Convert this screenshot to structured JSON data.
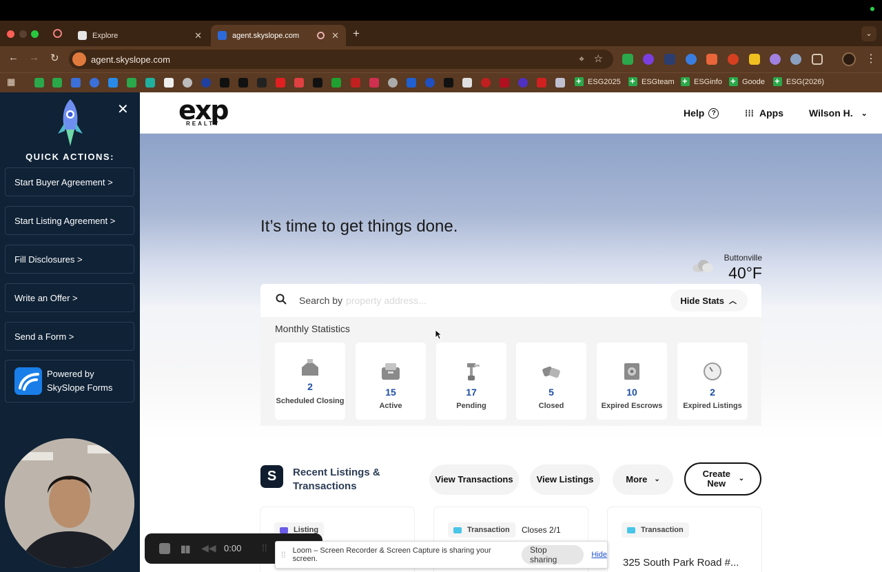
{
  "browser": {
    "tabs": [
      {
        "title": "Explore",
        "active": false
      },
      {
        "title": "agent.skyslope.com",
        "active": true
      }
    ],
    "url": "agent.skyslope.com",
    "bookmarks": [
      "ESG2025",
      "ESGteam",
      "ESGinfo",
      "Goode",
      "ESG(2026)"
    ]
  },
  "sidebar": {
    "title": "QUICK ACTIONS:",
    "actions": [
      "Start Buyer Agreement >",
      "Start Listing Agreement >",
      "Fill Disclosures >",
      "Write an Offer >",
      "Send a Form >"
    ],
    "powered_by": [
      "Powered by",
      "SkySlope Forms"
    ]
  },
  "header": {
    "logo_main": "exp",
    "logo_sub": "REALTY",
    "help": "Help",
    "apps": "Apps",
    "user": "Wilson H."
  },
  "hero": {
    "tagline": "It’s time to get things done.",
    "weather_city": "Buttonville",
    "weather_temp": "40°F",
    "search_label": "Search by",
    "search_placeholder": "property address...",
    "hide_stats": "Hide Stats"
  },
  "stats": {
    "title": "Monthly Statistics",
    "items": [
      {
        "value": "2",
        "label": "Scheduled Closing"
      },
      {
        "value": "15",
        "label": "Active"
      },
      {
        "value": "17",
        "label": "Pending"
      },
      {
        "value": "5",
        "label": "Closed"
      },
      {
        "value": "10",
        "label": "Expired Escrows"
      },
      {
        "value": "2",
        "label": "Expired Listings"
      }
    ]
  },
  "recent": {
    "title": "Recent Listings & Transactions",
    "view_transactions": "View Transactions",
    "view_listings": "View Listings",
    "more": "More",
    "create_new": "Create New",
    "cards": [
      {
        "type": "Listing",
        "closes": "",
        "address": "",
        "tag_color": "#6b5ce7"
      },
      {
        "type": "Transaction",
        "closes": "Closes 2/1",
        "address": "",
        "tag_color": "#49c5e8"
      },
      {
        "type": "Transaction",
        "closes": "",
        "address": "325 South Park Road #...",
        "tag_color": "#49c5e8"
      }
    ]
  },
  "recorder": {
    "time": "0:00",
    "share_message": "Loom – Screen Recorder & Screen Capture is sharing your screen.",
    "stop_sharing": "Stop sharing",
    "hide": "Hide"
  },
  "colors": {
    "sidebar_bg": "#0f2236",
    "stat_number": "#1d4ea6",
    "browser_chrome": "#5a3a22"
  }
}
